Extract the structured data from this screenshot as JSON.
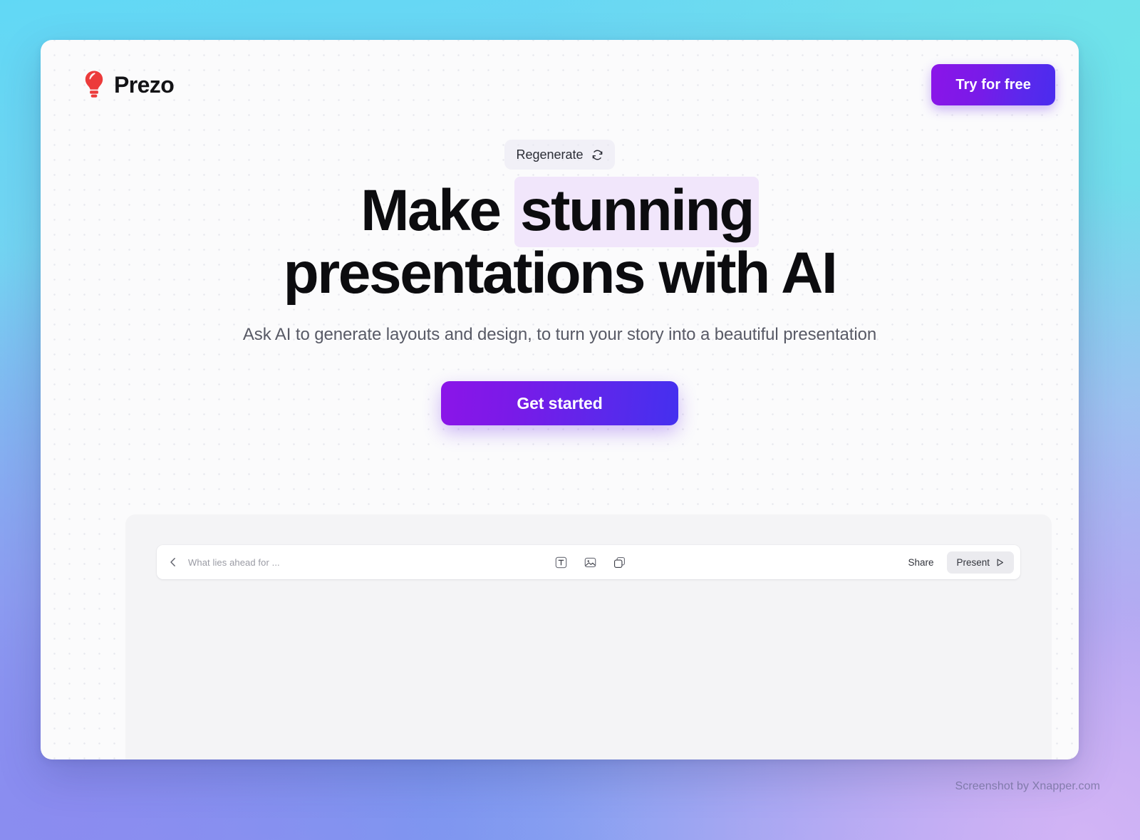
{
  "header": {
    "brand_name": "Prezo",
    "brand_logo_icon": "lightbulb-icon",
    "brand_logo_color": "#ec3b3b",
    "cta_label": "Try for free",
    "cta_gradient_from": "#8b15e8",
    "cta_gradient_to": "#4a2cee"
  },
  "hero": {
    "regenerate_label": "Regenerate",
    "regenerate_icon": "refresh-icon",
    "headline_part1": "Make ",
    "headline_highlight": "stunning",
    "headline_part2": " presentations with AI",
    "highlight_color": "#f1e6fb",
    "subheadline": "Ask AI to generate layouts and design, to turn your story into a beautiful presentation",
    "primary_cta_label": "Get started",
    "primary_cta_gradient_from": "#8b15e8",
    "primary_cta_gradient_to": "#4430ef"
  },
  "editor": {
    "deck_title": "What lies ahead for ...",
    "back_icon": "chevron-left-icon",
    "tools": [
      {
        "name": "text-tool-icon",
        "label": "Text"
      },
      {
        "name": "image-tool-icon",
        "label": "Image"
      },
      {
        "name": "shape-tool-icon",
        "label": "Shape"
      }
    ],
    "share_label": "Share",
    "present_label": "Present",
    "present_icon": "play-icon"
  },
  "watermark": {
    "text": "Screenshot by Xnapper.com"
  },
  "background": {
    "top_left": "#61d8f5",
    "top_right": "#6fe3ea",
    "bottom_left": "#8b8cf0",
    "bottom_right": "#d2b4f5"
  }
}
